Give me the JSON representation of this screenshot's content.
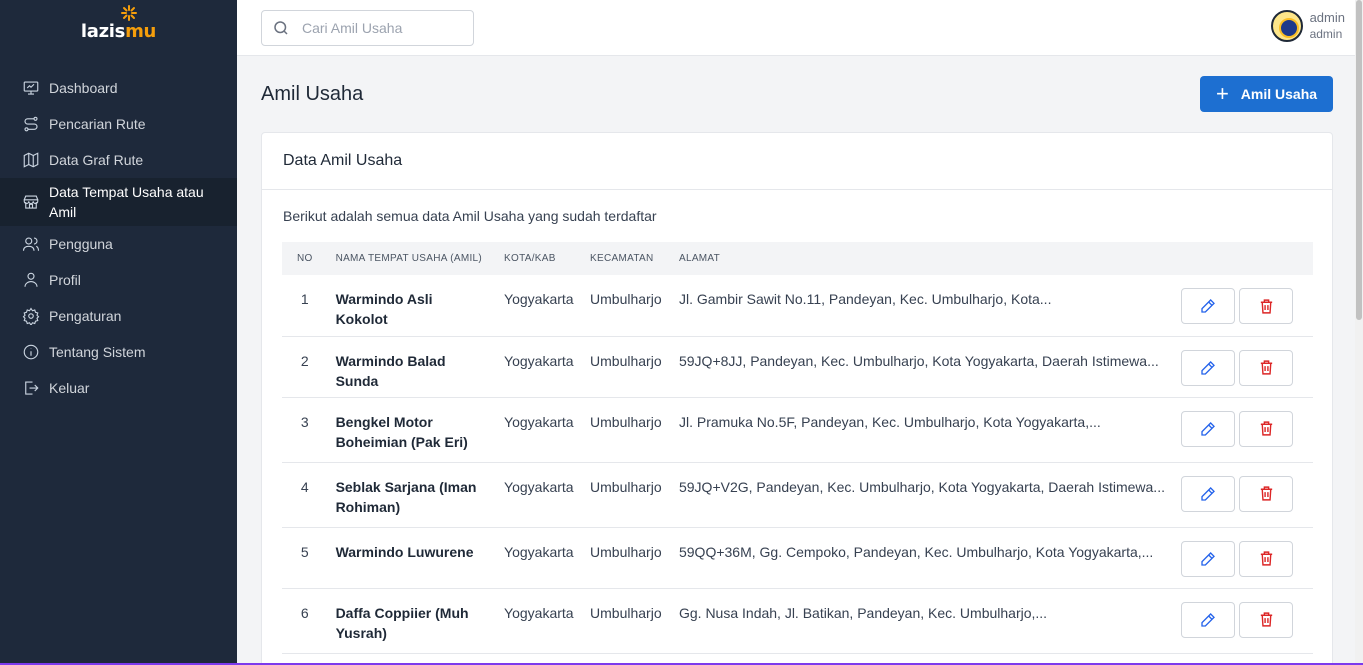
{
  "brand": {
    "name_a": "lazis",
    "name_b": "mu",
    "accent": "#f59e0b"
  },
  "sidebar": {
    "items": [
      {
        "label": "Dashboard",
        "icon": "monitor-icon"
      },
      {
        "label": "Pencarian Rute",
        "icon": "route-icon"
      },
      {
        "label": "Data Graf Rute",
        "icon": "map-icon"
      },
      {
        "label": "Data Tempat Usaha atau Amil",
        "icon": "store-icon",
        "active": true
      },
      {
        "label": "Pengguna",
        "icon": "users-icon"
      },
      {
        "label": "Profil",
        "icon": "user-icon"
      },
      {
        "label": "Pengaturan",
        "icon": "gear-icon"
      },
      {
        "label": "Tentang Sistem",
        "icon": "info-icon"
      },
      {
        "label": "Keluar",
        "icon": "logout-icon"
      }
    ]
  },
  "topbar": {
    "search_placeholder": "Cari Amil Usaha",
    "user_name": "admin",
    "user_role": "admin"
  },
  "page": {
    "title": "Amil Usaha",
    "add_button": "Amil Usaha"
  },
  "card": {
    "title": "Data Amil Usaha",
    "description": "Berikut adalah semua data Amil Usaha yang sudah terdaftar",
    "columns": [
      "NO",
      "NAMA TEMPAT USAHA (AMIL)",
      "KOTA/KAB",
      "KECAMATAN",
      "ALAMAT"
    ],
    "rows": [
      {
        "no": "1",
        "name": "Warmindo Asli Kokolot",
        "kota": "Yogyakarta",
        "kec": "Umbulharjo",
        "alamat": "Jl. Gambir Sawit No.11, Pandeyan, Kec. Umbulharjo, Kota..."
      },
      {
        "no": "2",
        "name": "Warmindo Balad Sunda",
        "kota": "Yogyakarta",
        "kec": "Umbulharjo",
        "alamat": "59JQ+8JJ, Pandeyan, Kec. Umbulharjo, Kota Yogyakarta, Daerah Istimewa..."
      },
      {
        "no": "3",
        "name": "Bengkel Motor Boheimian (Pak Eri)",
        "kota": "Yogyakarta",
        "kec": "Umbulharjo",
        "alamat": "Jl. Pramuka No.5F, Pandeyan, Kec. Umbulharjo, Kota Yogyakarta,..."
      },
      {
        "no": "4",
        "name": "Seblak Sarjana (Iman Rohiman)",
        "kota": "Yogyakarta",
        "kec": "Umbulharjo",
        "alamat": "59JQ+V2G, Pandeyan, Kec. Umbulharjo, Kota Yogyakarta, Daerah Istimewa..."
      },
      {
        "no": "5",
        "name": "Warmindo Luwurene",
        "kota": "Yogyakarta",
        "kec": "Umbulharjo",
        "alamat": "59QQ+36M, Gg. Cempoko, Pandeyan, Kec. Umbulharjo, Kota Yogyakarta,..."
      },
      {
        "no": "6",
        "name": "Daffa Coppiier (Muh Yusrah)",
        "kota": "Yogyakarta",
        "kec": "Umbulharjo",
        "alamat": "Gg. Nusa Indah, Jl. Batikan, Pandeyan, Kec. Umbulharjo,..."
      }
    ]
  }
}
